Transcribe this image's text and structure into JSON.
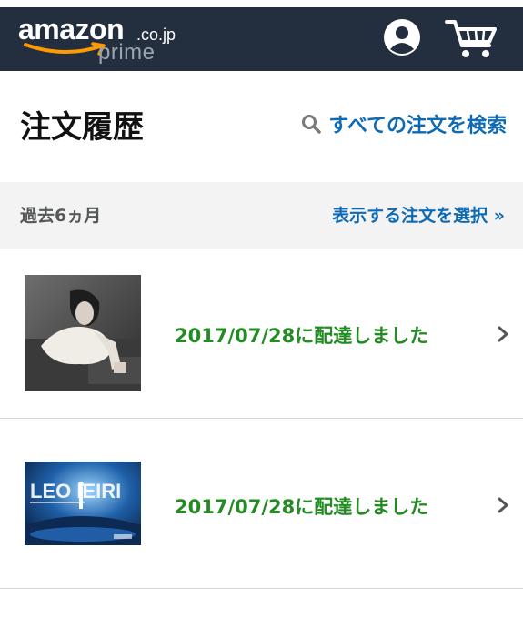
{
  "header": {
    "logo_word": "amazon",
    "logo_tld": ".co.jp",
    "logo_sub": "prime",
    "account_icon": "account-icon",
    "cart_icon": "cart-icon",
    "bg_color": "#232f3e"
  },
  "page": {
    "title": "注文履歴",
    "search_link": "すべての注文を検索"
  },
  "filter": {
    "range": "過去6ヵ月",
    "select_label": "表示する注文を選択 »"
  },
  "orders": [
    {
      "status": "2017/07/28に配達しました",
      "thumb": "album-cover-woman"
    },
    {
      "status": "2017/07/28に配達しました",
      "thumb": "dvd-cover-leo-ieiri"
    }
  ],
  "colors": {
    "link": "#0f6ab4",
    "delivered": "#228b22",
    "filter_bg": "#f3f3f3"
  }
}
